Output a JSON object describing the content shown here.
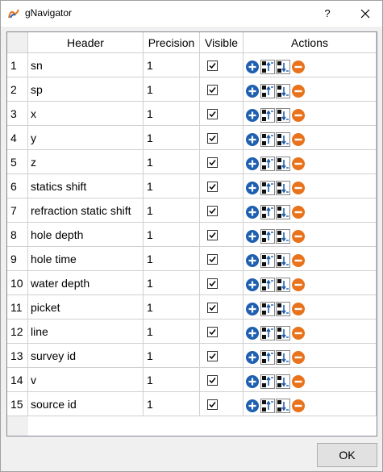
{
  "window": {
    "title": "gNavigator",
    "help_label": "?"
  },
  "table": {
    "columns": [
      "Header",
      "Precision",
      "Visible",
      "Actions"
    ],
    "rows": [
      {
        "num": "1",
        "header": "sn",
        "precision": "1",
        "visible": true
      },
      {
        "num": "2",
        "header": "sp",
        "precision": "1",
        "visible": true
      },
      {
        "num": "3",
        "header": "x",
        "precision": "1",
        "visible": true
      },
      {
        "num": "4",
        "header": "y",
        "precision": "1",
        "visible": true
      },
      {
        "num": "5",
        "header": "z",
        "precision": "1",
        "visible": true
      },
      {
        "num": "6",
        "header": "statics shift",
        "precision": "1",
        "visible": true
      },
      {
        "num": "7",
        "header": "refraction static shift",
        "precision": "1",
        "visible": true
      },
      {
        "num": "8",
        "header": "hole depth",
        "precision": "1",
        "visible": true
      },
      {
        "num": "9",
        "header": "hole time",
        "precision": "1",
        "visible": true
      },
      {
        "num": "10",
        "header": "water depth",
        "precision": "1",
        "visible": true
      },
      {
        "num": "11",
        "header": "picket",
        "precision": "1",
        "visible": true
      },
      {
        "num": "12",
        "header": "line",
        "precision": "1",
        "visible": true
      },
      {
        "num": "13",
        "header": "survey id",
        "precision": "1",
        "visible": true
      },
      {
        "num": "14",
        "header": "v",
        "precision": "1",
        "visible": true
      },
      {
        "num": "15",
        "header": "source id",
        "precision": "1",
        "visible": true
      }
    ],
    "actions": [
      "add-icon",
      "move-up-icon",
      "move-down-icon",
      "remove-icon"
    ]
  },
  "footer": {
    "ok_label": "OK"
  },
  "colors": {
    "add": "#1f5fb0",
    "remove": "#e8731c",
    "grid": "#d0d0d0"
  }
}
